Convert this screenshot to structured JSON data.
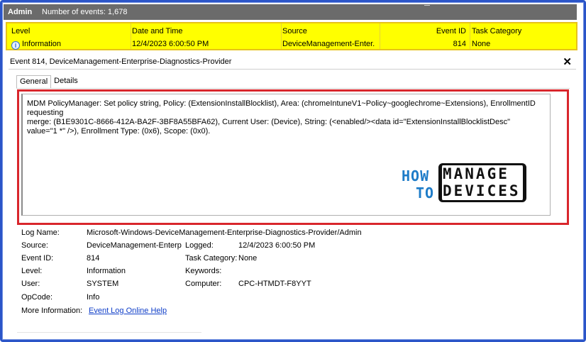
{
  "titlebar": {
    "section": "Admin",
    "events_count": "Number of events: 1,678"
  },
  "grid": {
    "headers": {
      "level": "Level",
      "date_time": "Date and Time",
      "source": "Source",
      "event_id": "Event ID",
      "task_category": "Task Category"
    },
    "row": {
      "level": "Information",
      "date_time": "12/4/2023 6:00:50 PM",
      "source": "DeviceManagement-Enter...",
      "event_id": "814",
      "task_category": "None"
    },
    "row_color": "#ffff00"
  },
  "event": {
    "title": "Event 814, DeviceManagement-Enterprise-Diagnostics-Provider",
    "close_symbol": "✕",
    "tabs": [
      "General",
      "Details"
    ],
    "description": "MDM PolicyManager: Set policy string, Policy: (ExtensionInstallBlocklist), Area: (chromeIntuneV1~Policy~googlechrome~Extensions), EnrollmentID requesting\nmerge: (B1E9301C-8666-412A-BA2F-3BF8A55BFA62), Current User: (Device), String: (<enabled/><data id=\"ExtensionInstallBlocklistDesc\"\nvalue=\"1 *\" />), Enrollment Type: (0x6), Scope: (0x0).",
    "highlight_color": "#d9262c"
  },
  "watermark": {
    "how": "HOW",
    "to": "TO",
    "manage": "MANAGE",
    "devices": "DEVICES"
  },
  "properties": {
    "log_name_label": "Log Name:",
    "log_name": "Microsoft-Windows-DeviceManagement-Enterprise-Diagnostics-Provider/Admin",
    "source_label": "Source:",
    "source": "DeviceManagement-Enterpr",
    "logged_label": "Logged:",
    "logged": "12/4/2023 6:00:50 PM",
    "event_id_label": "Event ID:",
    "event_id": "814",
    "task_category_label": "Task Category:",
    "task_category": "None",
    "level_label": "Level:",
    "level": "Information",
    "keywords_label": "Keywords:",
    "user_label": "User:",
    "user": "SYSTEM",
    "computer_label": "Computer:",
    "computer": "CPC-HTMDT-F8YYT",
    "opcode_label": "OpCode:",
    "opcode": "Info",
    "more_info_label": "More Information:",
    "more_info_link": "Event Log Online Help"
  }
}
